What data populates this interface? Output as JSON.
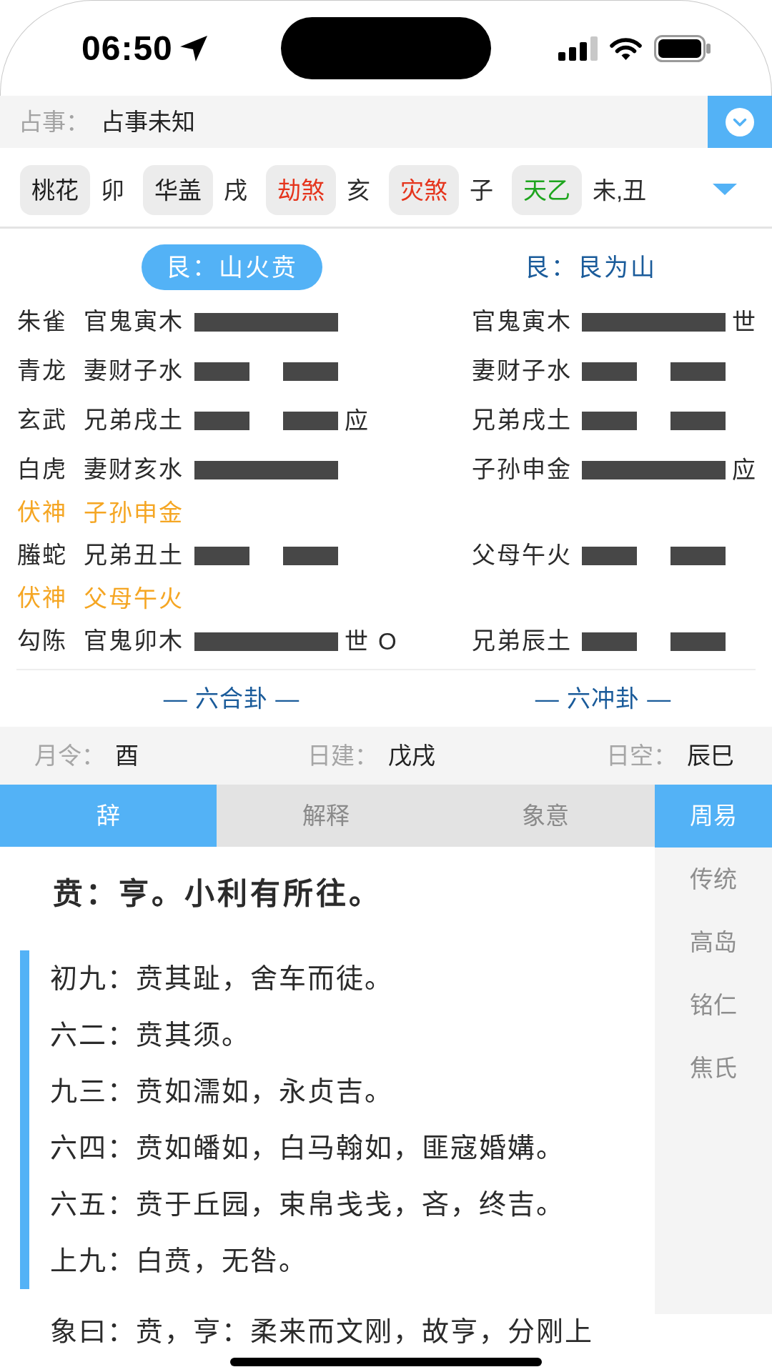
{
  "status_bar": {
    "time": "06:50"
  },
  "question": {
    "label": "占事：",
    "value": "占事未知"
  },
  "shensha": [
    {
      "name": "桃花",
      "branch": "卯",
      "color": "#1f1f1f"
    },
    {
      "name": "华盖",
      "branch": "戌",
      "color": "#1f1f1f"
    },
    {
      "name": "劫煞",
      "branch": "亥",
      "color": "#e5341c"
    },
    {
      "name": "灾煞",
      "branch": "子",
      "color": "#e5341c"
    },
    {
      "name": "天乙",
      "branch": "未,丑",
      "color": "#1ea51e"
    }
  ],
  "hexagrams": [
    {
      "title": "艮：山火贲",
      "selected": true,
      "footer": "— 六合卦 —"
    },
    {
      "title": "艮：艮为山",
      "selected": false,
      "footer": "— 六冲卦 —"
    }
  ],
  "hexagram_lines": [
    {
      "kind": "yao",
      "spirit": "朱雀",
      "main": {
        "relation": "官鬼寅木",
        "kind": "yang"
      },
      "changed": {
        "relation": "官鬼寅木",
        "kind": "yang",
        "mark": "世"
      }
    },
    {
      "kind": "yao",
      "spirit": "青龙",
      "main": {
        "relation": "妻财子水",
        "kind": "yin"
      },
      "changed": {
        "relation": "妻财子水",
        "kind": "yin"
      }
    },
    {
      "kind": "yao",
      "spirit": "玄武",
      "main": {
        "relation": "兄弟戌土",
        "kind": "yin",
        "mark": "应"
      },
      "changed": {
        "relation": "兄弟戌土",
        "kind": "yin"
      }
    },
    {
      "kind": "yao",
      "spirit": "白虎",
      "main": {
        "relation": "妻财亥水",
        "kind": "yang"
      },
      "changed": {
        "relation": "子孙申金",
        "kind": "yang",
        "mark": "应"
      }
    },
    {
      "kind": "hidden",
      "spirit": "伏神",
      "relation": "子孙申金"
    },
    {
      "kind": "yao",
      "spirit": "螣蛇",
      "main": {
        "relation": "兄弟丑土",
        "kind": "yin"
      },
      "changed": {
        "relation": "父母午火",
        "kind": "yin"
      }
    },
    {
      "kind": "hidden",
      "spirit": "伏神",
      "relation": "父母午火"
    },
    {
      "kind": "yao",
      "spirit": "勾陈",
      "main": {
        "relation": "官鬼卯木",
        "kind": "yang",
        "mark": "世",
        "moving": "O"
      },
      "changed": {
        "relation": "兄弟辰土",
        "kind": "yin"
      }
    }
  ],
  "day_info": [
    {
      "label": "月令：",
      "value": "酉"
    },
    {
      "label": "日建：",
      "value": "戊戌"
    },
    {
      "label": "日空：",
      "value": "辰巳"
    }
  ],
  "tabs": [
    {
      "label": "辞",
      "selected": true
    },
    {
      "label": "解释",
      "selected": false
    },
    {
      "label": "象意",
      "selected": false
    }
  ],
  "sources": [
    {
      "label": "周易",
      "selected": true
    },
    {
      "label": "传统",
      "selected": false
    },
    {
      "label": "高岛",
      "selected": false
    },
    {
      "label": "铭仁",
      "selected": false
    },
    {
      "label": "焦氏",
      "selected": false
    }
  ],
  "content": {
    "heading": "贲：亨。小利有所往。",
    "lines": [
      "初九：贲其趾，舍车而徒。",
      "六二：贲其须。",
      "九三：贲如濡如，永贞吉。",
      "六四：贲如皤如，白马翰如，匪寇婚媾。",
      "六五：贲于丘园，束帛戋戋，吝，终吉。",
      "上九：白贲，无咎。"
    ],
    "commentary": "象曰：贲，亨：柔来而文刚，故亨，分刚上"
  }
}
